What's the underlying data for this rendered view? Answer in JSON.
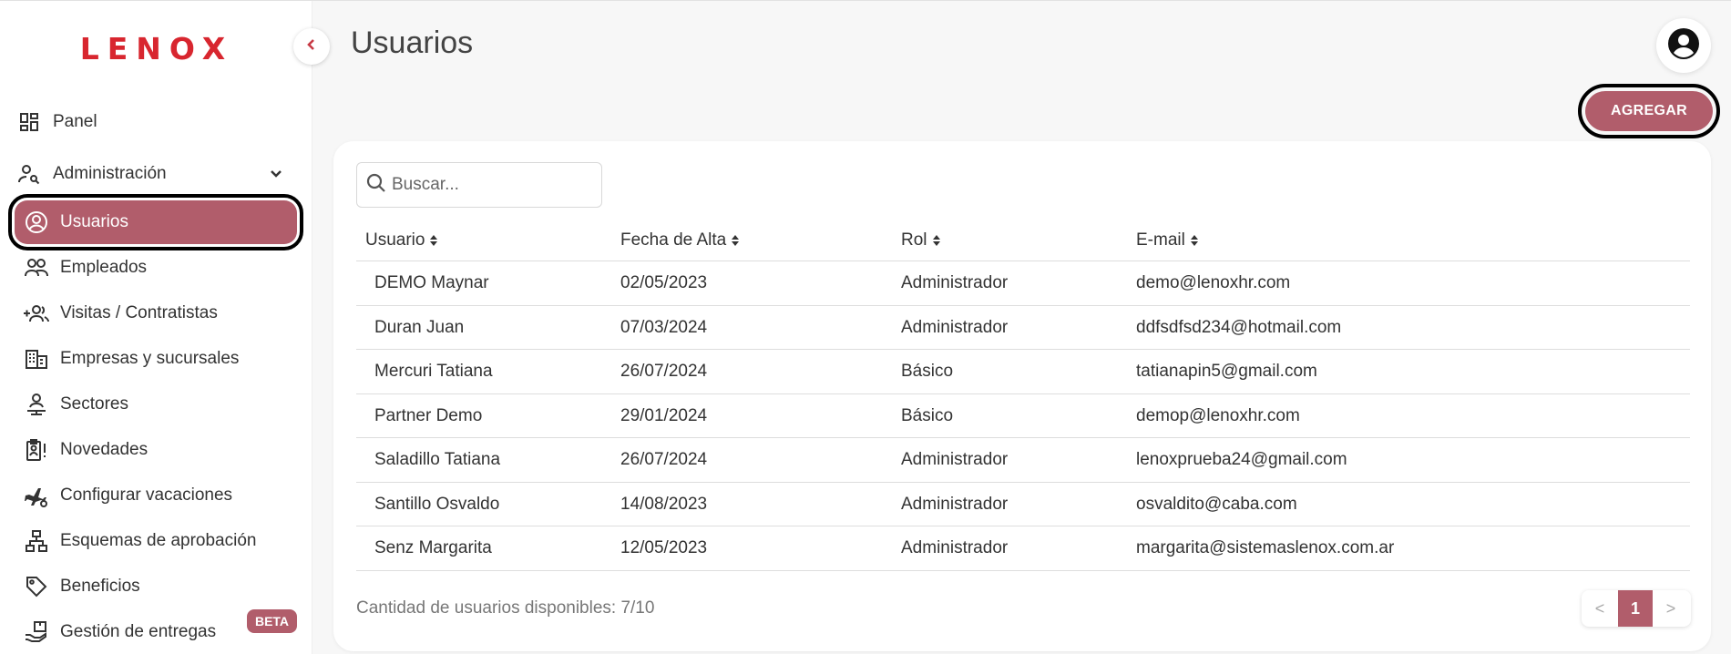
{
  "app": {
    "logo_text": "LENOX",
    "page_title": "Usuarios",
    "brand_color": "#b15d6b"
  },
  "sidebar": {
    "items": [
      {
        "label": "Panel",
        "icon": "dashboard-icon"
      },
      {
        "label": "Administración",
        "icon": "admin-icon"
      },
      {
        "label": "Usuarios",
        "icon": "account-circle-icon"
      },
      {
        "label": "Empleados",
        "icon": "people-icon"
      },
      {
        "label": "Visitas / Contratistas",
        "icon": "add-people-icon"
      },
      {
        "label": "Empresas y sucursales",
        "icon": "building-icon"
      },
      {
        "label": "Sectores",
        "icon": "sector-person-icon"
      },
      {
        "label": "Novedades",
        "icon": "badge-alert-icon"
      },
      {
        "label": "Configurar vacaciones",
        "icon": "plane-settings-icon"
      },
      {
        "label": "Esquemas de aprobación",
        "icon": "hierarchy-icon"
      },
      {
        "label": "Beneficios",
        "icon": "tag-icon"
      },
      {
        "label": "Gestión de entregas",
        "icon": "hand-box-icon"
      }
    ],
    "beta_badge": "BETA"
  },
  "toolbar": {
    "add_label": "AGREGAR"
  },
  "search": {
    "placeholder": "Buscar..."
  },
  "table": {
    "columns": [
      "Usuario",
      "Fecha de Alta",
      "Rol",
      "E-mail"
    ],
    "rows": [
      [
        "DEMO Maynar",
        "02/05/2023",
        "Administrador",
        "demo@lenoxhr.com"
      ],
      [
        "Duran Juan",
        "07/03/2024",
        "Administrador",
        "ddfsdfsd234@hotmail.com"
      ],
      [
        "Mercuri Tatiana",
        "26/07/2024",
        "Básico",
        "tatianapin5@gmail.com"
      ],
      [
        "Partner Demo",
        "29/01/2024",
        "Básico",
        "demop@lenoxhr.com"
      ],
      [
        "Saladillo Tatiana",
        "26/07/2024",
        "Administrador",
        "lenoxprueba24@gmail.com"
      ],
      [
        "Santillo Osvaldo",
        "14/08/2023",
        "Administrador",
        "osvaldito@caba.com"
      ],
      [
        "Senz Margarita",
        "12/05/2023",
        "Administrador",
        "margarita@sistemaslenox.com.ar"
      ]
    ]
  },
  "footer": {
    "available_text": "Cantidad de usuarios disponibles: 7/10"
  },
  "pagination": {
    "prev": "<",
    "current": "1",
    "next": ">"
  }
}
